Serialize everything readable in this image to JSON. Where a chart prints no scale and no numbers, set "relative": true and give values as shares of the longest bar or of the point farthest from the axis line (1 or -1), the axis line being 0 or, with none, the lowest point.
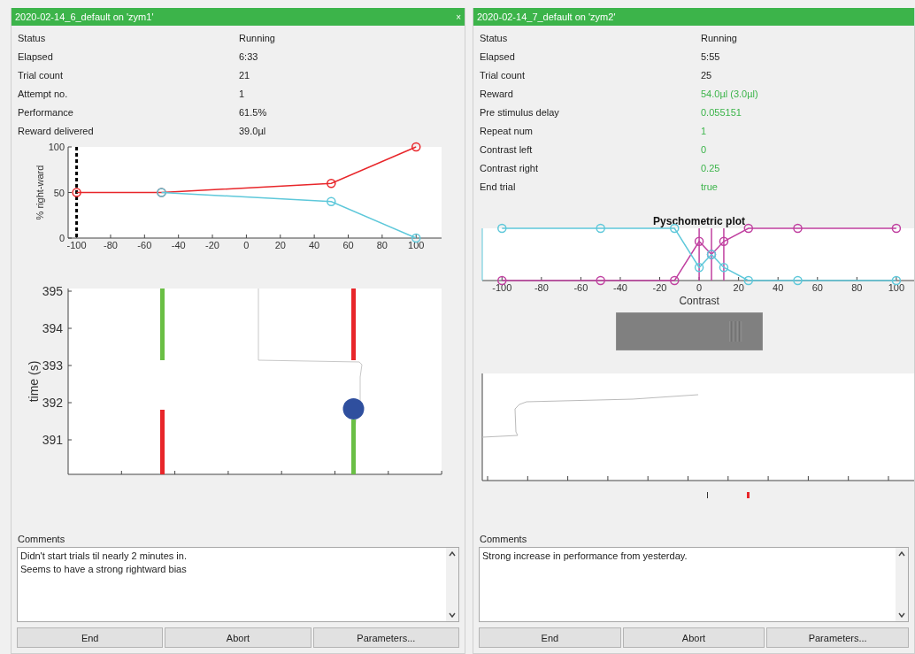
{
  "panels": [
    {
      "title": "2020-02-14_6_default on 'zym1'",
      "close": "×",
      "info": [
        {
          "label": "Status",
          "value": "Running",
          "kind": "stat"
        },
        {
          "label": "Elapsed",
          "value": "6:33",
          "kind": "stat"
        },
        {
          "label": "Trial count",
          "value": "21",
          "kind": "stat"
        },
        {
          "label": "Attempt no.",
          "value": "1",
          "kind": "stat"
        },
        {
          "label": "Performance",
          "value": "61.5%",
          "kind": "stat"
        },
        {
          "label": "Reward delivered",
          "value": "39.0µl",
          "kind": "stat"
        }
      ],
      "chart_data": {
        "type": "line",
        "ylabel": "% right-ward",
        "x": [
          -100,
          -50,
          50,
          100
        ],
        "xlim": [
          -105,
          115
        ],
        "ylim": [
          0,
          100
        ],
        "xticks": [
          -100,
          -80,
          -60,
          -40,
          -20,
          0,
          20,
          40,
          60,
          80,
          100
        ],
        "yticks": [
          0,
          50,
          100
        ],
        "series": [
          {
            "color": "#e8262a",
            "marker": "o",
            "values": [
              50,
              50,
              60,
              100
            ]
          },
          {
            "color": "#5ec8da",
            "marker": "o",
            "values": [
              null,
              50,
              40,
              0
            ]
          }
        ],
        "ref_lines": [
          {
            "axis": "x",
            "value": -100,
            "color": "#000000"
          }
        ]
      },
      "time_plot": {
        "ylabel": "time (s)",
        "yticks": [
          "395",
          "394",
          "393",
          "392",
          "391"
        ]
      },
      "comments_label": "Comments",
      "comments": "Didn't start trials til nearly 2 minutes in.\nSeems to have a strong rightward bias",
      "buttons": [
        "End",
        "Abort",
        "Parameters..."
      ]
    },
    {
      "title": "2020-02-14_7_default on 'zym2'",
      "info": [
        {
          "label": "Status",
          "value": "Running",
          "kind": "stat"
        },
        {
          "label": "Elapsed",
          "value": "5:55",
          "kind": "stat"
        },
        {
          "label": "Trial count",
          "value": "25",
          "kind": "stat"
        },
        {
          "label": "Reward",
          "value": "54.0µl (3.0µl)",
          "kind": "param"
        },
        {
          "label": "Pre stimulus delay",
          "value": "0.055151",
          "kind": "param"
        },
        {
          "label": "Repeat num",
          "value": "1",
          "kind": "param"
        },
        {
          "label": "Contrast left",
          "value": "0",
          "kind": "param"
        },
        {
          "label": "Contrast right",
          "value": "0.25",
          "kind": "param"
        },
        {
          "label": "End trial",
          "value": "true",
          "kind": "param"
        }
      ],
      "chart_data": {
        "type": "line",
        "title": "Pyschometric plot",
        "xlabel": "Contrast",
        "x": [
          -100,
          -50,
          -12.5,
          0,
          6.25,
          12.5,
          25,
          50,
          100
        ],
        "xlim": [
          -110,
          118
        ],
        "relative": true,
        "xticks": [
          -100,
          -80,
          -60,
          -40,
          -20,
          0,
          20,
          40,
          60,
          80,
          100
        ],
        "series": [
          {
            "color": "#c040a0",
            "marker": "o",
            "values": [
              0,
              0,
              0,
              0.75,
              0.5,
              0.75,
              1,
              1,
              1
            ]
          },
          {
            "color": "#5ec8da",
            "marker": "o",
            "values": [
              1,
              1,
              1,
              0.25,
              0.5,
              0.25,
              0,
              0,
              0
            ]
          }
        ],
        "ref_lines": [
          {
            "axis": "x",
            "value": 0,
            "color": "#c040a0"
          },
          {
            "axis": "x",
            "value": 6.25,
            "color": "#c040a0"
          },
          {
            "axis": "x",
            "value": 12.5,
            "color": "#c040a0"
          }
        ]
      },
      "comments_label": "Comments",
      "comments": "Strong increase in performance from yesterday.",
      "buttons": [
        "End",
        "Abort",
        "Parameters..."
      ]
    }
  ]
}
